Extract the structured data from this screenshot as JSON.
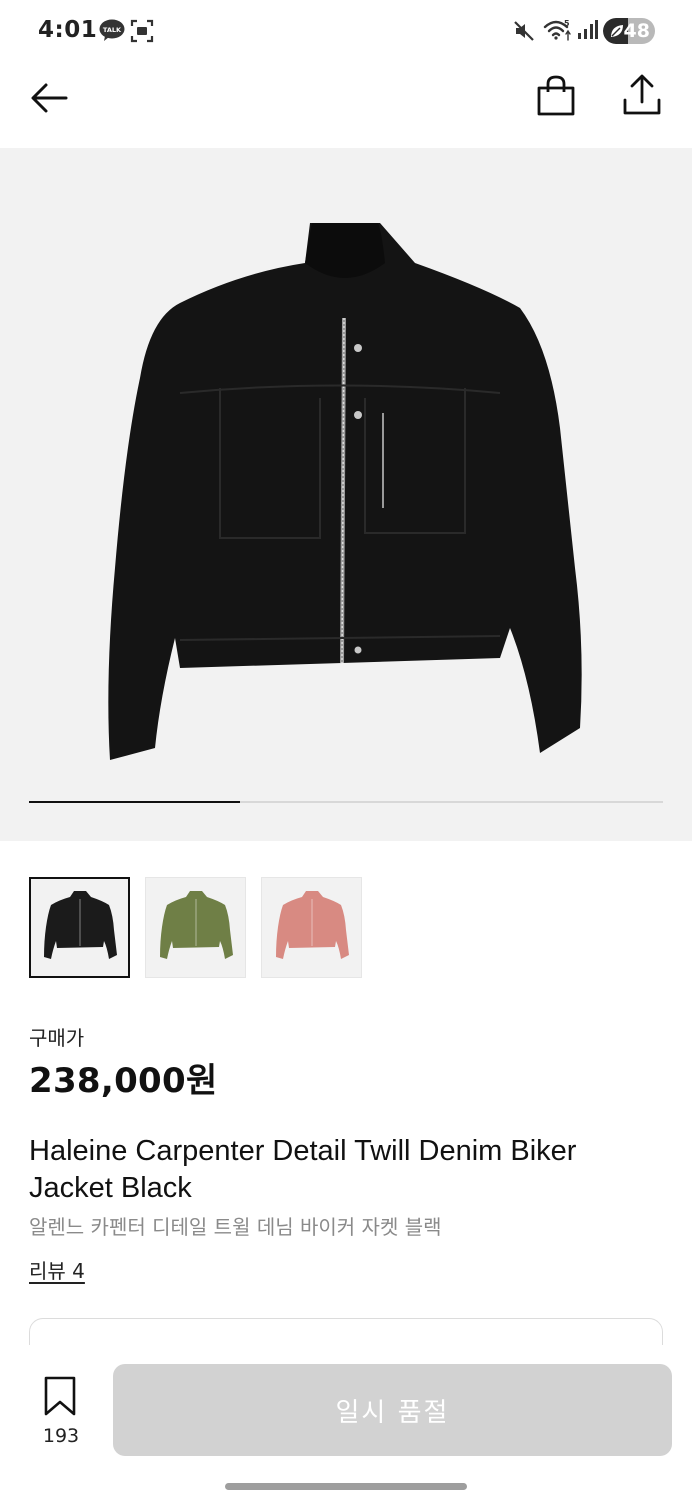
{
  "status_bar": {
    "time": "4:01",
    "battery_level": "48",
    "battery_fraction": 0.48,
    "icons": [
      "kakaotalk-icon",
      "screenshot-icon",
      "mute-icon",
      "wifi-icon",
      "signal-icon",
      "battery-icon"
    ]
  },
  "app_bar": {
    "icons": [
      "back-arrow-icon",
      "shopping-bag-icon",
      "share-icon"
    ]
  },
  "gallery": {
    "progress_fraction": 0.333,
    "thumbnails": [
      {
        "color_name": "black",
        "color": "#1b1b1b",
        "selected": true
      },
      {
        "color_name": "green",
        "color": "#6f7f46",
        "selected": false
      },
      {
        "color_name": "pink",
        "color": "#d88a82",
        "selected": false
      }
    ]
  },
  "product": {
    "price_label": "구매가",
    "price": "238,000원",
    "title_en": "Haleine Carpenter Detail Twill Denim Biker Jacket Black",
    "title_ko": "알렌느 카펜터 디테일 트윌 데님 바이커 자켓 블랙",
    "review_link": "리뷰 4"
  },
  "bottom_bar": {
    "wish_count": "193",
    "action_label": "일시 품절"
  },
  "colors": {
    "background": "#ffffff",
    "image_background": "#f2f2f2",
    "disabled_button": "#d2d2d2",
    "text_primary": "#111111",
    "text_secondary": "#8a8a8a"
  }
}
